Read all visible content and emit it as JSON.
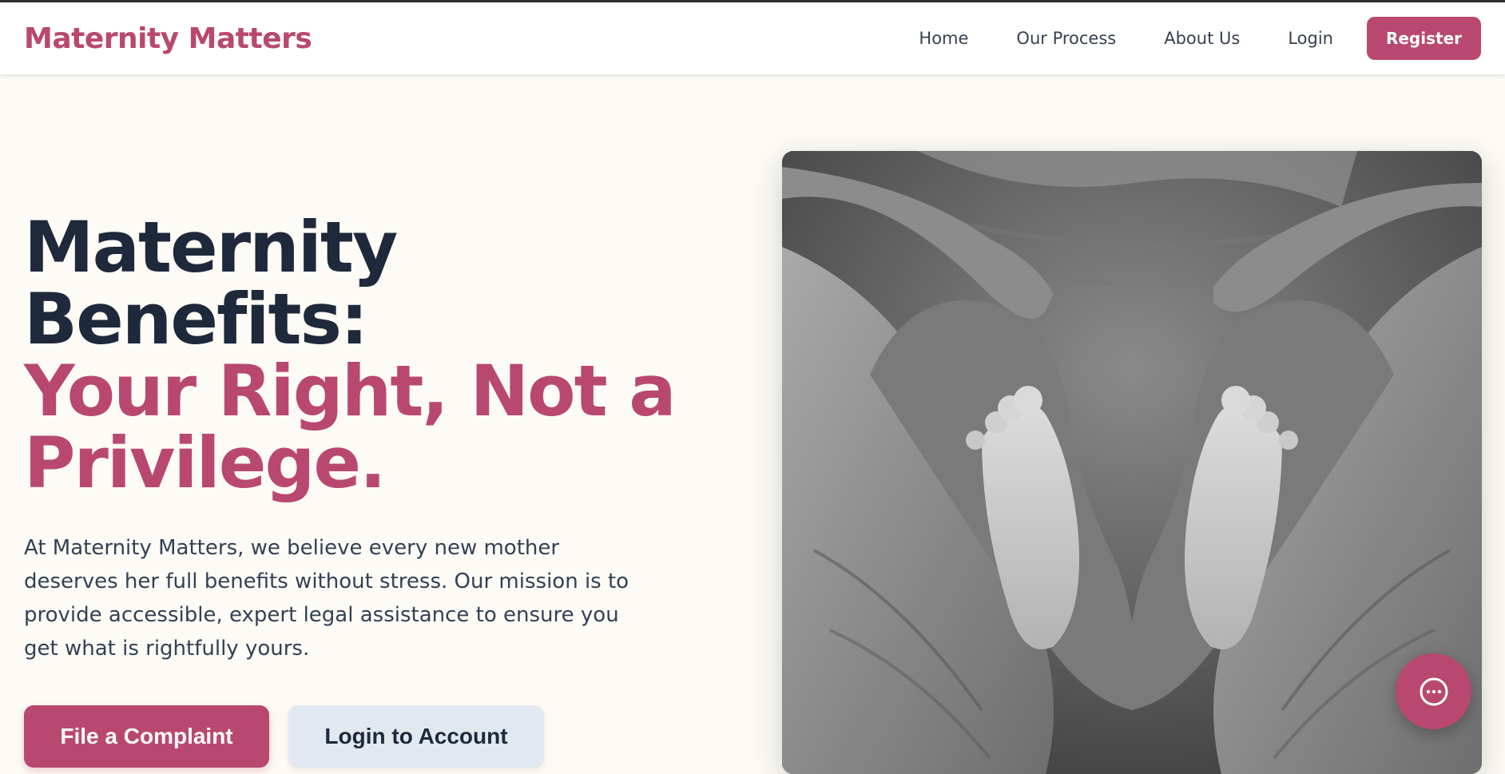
{
  "header": {
    "brand": "Maternity Matters",
    "nav": [
      {
        "label": "Home"
      },
      {
        "label": "Our Process"
      },
      {
        "label": "About Us"
      },
      {
        "label": "Login"
      }
    ],
    "register_label": "Register"
  },
  "hero": {
    "title_line1": "Maternity",
    "title_line2": "Benefits:",
    "title_accent_line1": "Your Right, Not a",
    "title_accent_line2": "Privilege.",
    "description": "At Maternity Matters, we believe every new mother deserves her full benefits without stress. Our mission is to provide accessible, expert legal assistance to ensure you get what is rightfully yours.",
    "primary_cta": "File a Complaint",
    "secondary_cta": "Login to Account"
  },
  "image": {
    "alt": "Hands forming a heart around baby feet"
  },
  "chat": {
    "icon": "chat-bubble-icon"
  },
  "colors": {
    "brand": "#b94870",
    "heading": "#1e293b",
    "body_text": "#334155",
    "background": "#fdfbf5",
    "secondary_button": "#e2e8f0"
  }
}
